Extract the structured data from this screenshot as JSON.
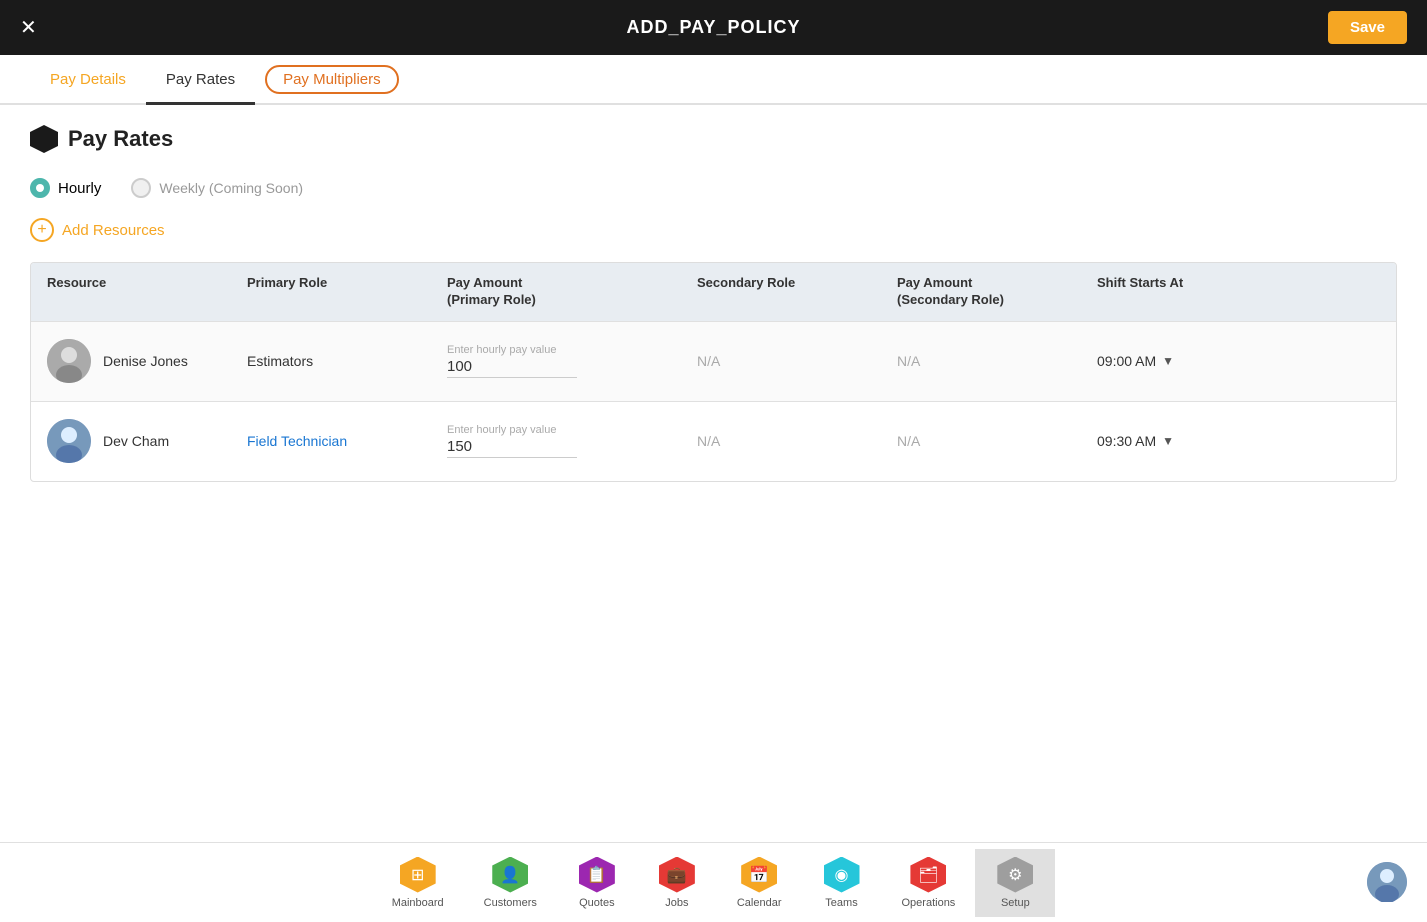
{
  "header": {
    "title": "ADD_PAY_POLICY",
    "close_label": "×",
    "save_label": "Save"
  },
  "tabs": [
    {
      "id": "pay-details",
      "label": "Pay Details"
    },
    {
      "id": "pay-rates",
      "label": "Pay Rates"
    },
    {
      "id": "pay-multipliers",
      "label": "Pay Multipliers"
    }
  ],
  "section": {
    "title": "Pay Rates"
  },
  "radio_options": [
    {
      "id": "hourly",
      "label": "Hourly",
      "active": true
    },
    {
      "id": "weekly",
      "label": "Weekly (Coming Soon)",
      "active": false
    }
  ],
  "add_resources_label": "Add Resources",
  "table": {
    "headers": [
      {
        "id": "resource",
        "label": "Resource"
      },
      {
        "id": "primary-role",
        "label": "Primary Role"
      },
      {
        "id": "pay-amount-primary",
        "label": "Pay Amount\n(Primary Role)"
      },
      {
        "id": "secondary-role",
        "label": "Secondary Role"
      },
      {
        "id": "pay-amount-secondary",
        "label": "Pay Amount\n(Secondary Role)"
      },
      {
        "id": "shift-starts-at",
        "label": "Shift Starts At"
      }
    ],
    "rows": [
      {
        "id": "row-denise",
        "resource_name": "Denise Jones",
        "primary_role": "Estimators",
        "pay_placeholder": "Enter hourly pay value",
        "pay_value": "100",
        "secondary_role": "N/A",
        "pay_secondary": "N/A",
        "shift_time": "09:00 AM"
      },
      {
        "id": "row-dev",
        "resource_name": "Dev Cham",
        "primary_role": "Field Technician",
        "pay_placeholder": "Enter hourly pay value",
        "pay_value": "150",
        "secondary_role": "N/A",
        "pay_secondary": "N/A",
        "shift_time": "09:30 AM"
      }
    ]
  },
  "bottom_nav": {
    "items": [
      {
        "id": "mainboard",
        "label": "Mainboard",
        "icon": "⊞",
        "color": "#f5a623"
      },
      {
        "id": "customers",
        "label": "Customers",
        "icon": "👤",
        "color": "#4caf50"
      },
      {
        "id": "quotes",
        "label": "Quotes",
        "icon": "📋",
        "color": "#9c27b0"
      },
      {
        "id": "jobs",
        "label": "Jobs",
        "icon": "💼",
        "color": "#e53935"
      },
      {
        "id": "calendar",
        "label": "Calendar",
        "icon": "📅",
        "color": "#f5a623"
      },
      {
        "id": "teams",
        "label": "Teams",
        "icon": "◉",
        "color": "#26c6da"
      },
      {
        "id": "operations",
        "label": "Operations",
        "icon": "🗂",
        "color": "#e53935"
      },
      {
        "id": "setup",
        "label": "Setup",
        "icon": "⚙",
        "color": "#9e9e9e"
      }
    ]
  }
}
